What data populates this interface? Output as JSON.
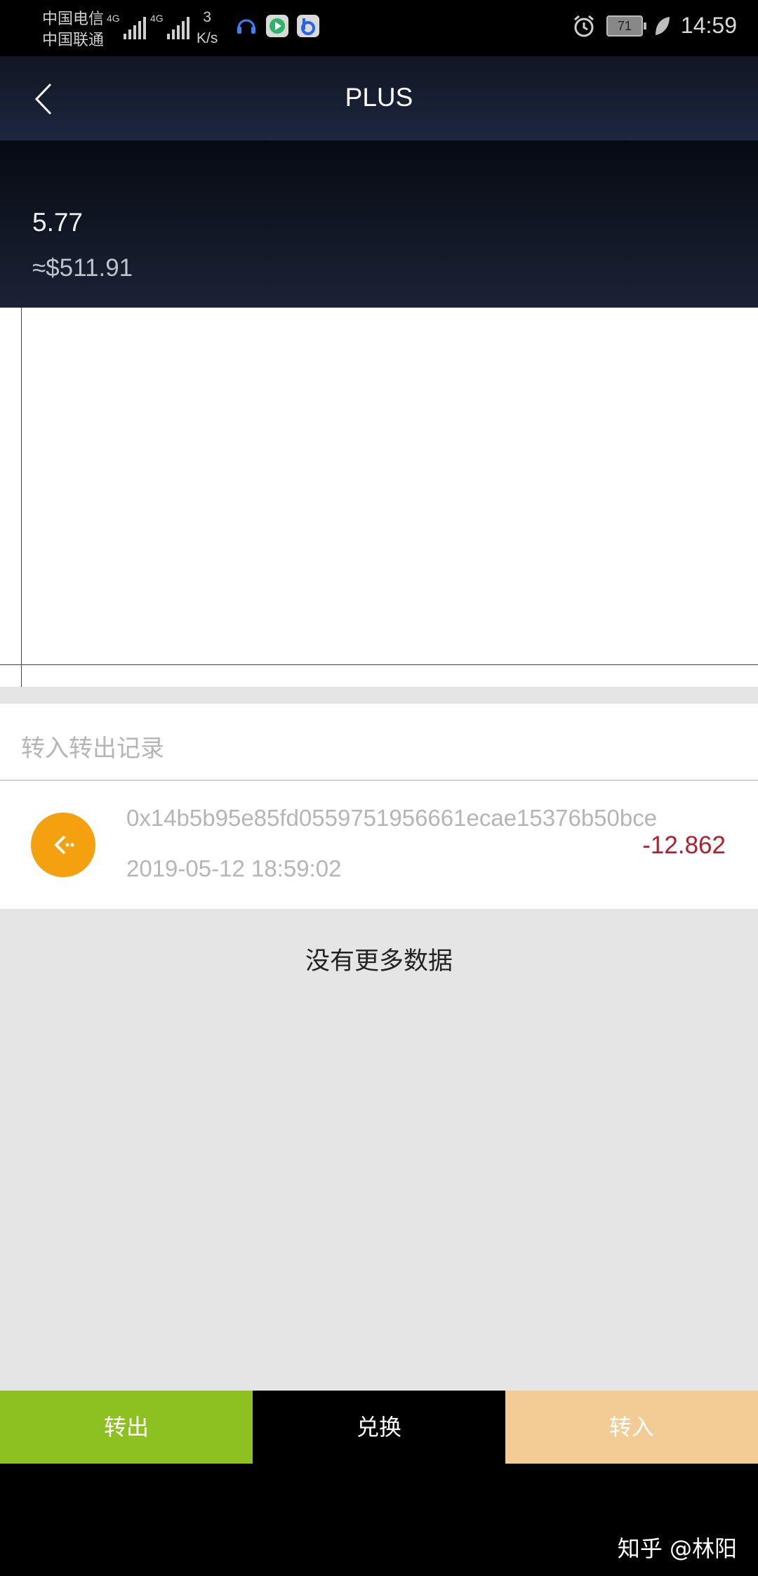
{
  "status_bar": {
    "carrier_1": "中国电信",
    "carrier_2": "中国联通",
    "network_1": "4G",
    "network_2": "4G",
    "speed_value": "3",
    "speed_unit": "K/s",
    "battery": "71",
    "time": "14:59"
  },
  "header": {
    "title": "PLUS"
  },
  "balance": {
    "amount": "5.77",
    "fiat": "≈$511.91"
  },
  "records": {
    "title": "转入转出记录",
    "items": [
      {
        "hash": "0x14b5b95e85fd0559751956661ecae15376b50bce",
        "date": "2019-05-12 18:59:02",
        "amount": "-12.862"
      }
    ],
    "no_more": "没有更多数据"
  },
  "actions": {
    "send": "转出",
    "swap": "兑换",
    "receive": "转入"
  },
  "watermark": "知乎 @林阳",
  "colors": {
    "send": "#8bc222",
    "swap": "#000000",
    "receive": "#f3cc95",
    "negative_amount": "#b41d2c",
    "record_icon": "#f5a00f"
  }
}
